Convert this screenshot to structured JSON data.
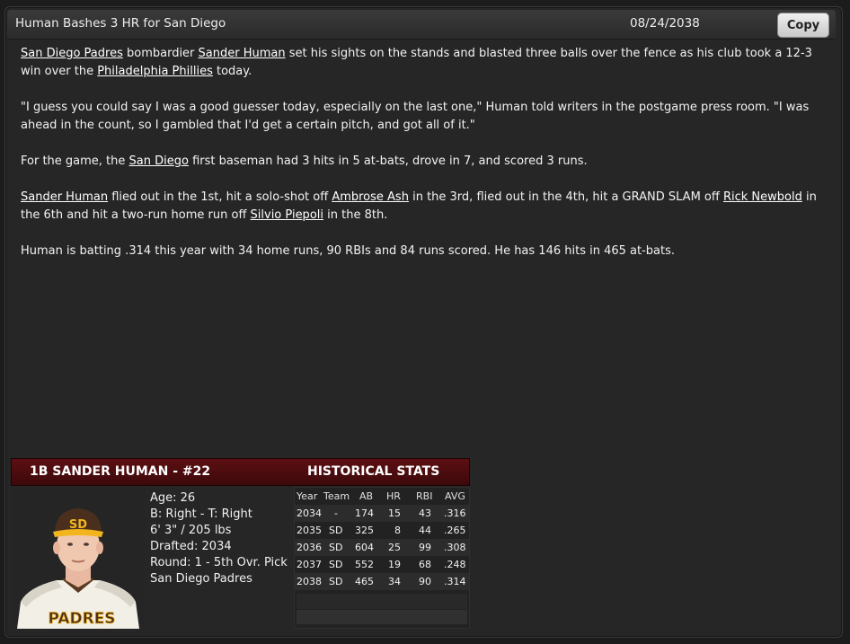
{
  "header": {
    "headline": "Human Bashes 3 HR for San Diego",
    "date": "08/24/2038",
    "copy_label": "Copy"
  },
  "article": {
    "p1": [
      {
        "text": "San Diego Padres",
        "link": true
      },
      {
        "text": " bombardier ",
        "link": false
      },
      {
        "text": "Sander Human",
        "link": true
      },
      {
        "text": " set his sights on the stands and blasted three balls over the fence as his club took a 12-3 win over the ",
        "link": false
      },
      {
        "text": "Philadelphia Phillies",
        "link": true
      },
      {
        "text": " today.",
        "link": false
      }
    ],
    "p2": [
      {
        "text": "\"I guess you could say I was a good guesser today, especially on the last one,\" Human told writers in the postgame press room. \"I was ahead in the count, so I gambled that I'd get a certain pitch, and got all of it.\"",
        "link": false
      }
    ],
    "p3": [
      {
        "text": "For the game, the ",
        "link": false
      },
      {
        "text": "San Diego",
        "link": true
      },
      {
        "text": " first baseman had 3 hits in 5 at-bats, drove in 7, and scored 3 runs.",
        "link": false
      }
    ],
    "p4": [
      {
        "text": "Sander Human",
        "link": true
      },
      {
        "text": " flied out in the 1st, hit a solo-shot off ",
        "link": false
      },
      {
        "text": "Ambrose Ash",
        "link": true
      },
      {
        "text": " in the 3rd, flied out in the 4th, hit a GRAND SLAM off ",
        "link": false
      },
      {
        "text": "Rick Newbold",
        "link": true
      },
      {
        "text": " in the 6th and hit a two-run home run off ",
        "link": false
      },
      {
        "text": "Silvio Piepoli",
        "link": true
      },
      {
        "text": " in the 8th.",
        "link": false
      }
    ],
    "p5": [
      {
        "text": "Human is batting .314 this year with 34 home runs, 90 RBIs and 84 runs scored. He has 146 hits in 465 at-bats.",
        "link": false
      }
    ]
  },
  "player_card": {
    "name": "1B SANDER HUMAN - #22",
    "hist_title": "HISTORICAL STATS",
    "bio": {
      "age": "Age: 26",
      "bats_throws": "B: Right - T: Right",
      "size": "6' 3\" / 205 lbs",
      "drafted": "Drafted: 2034",
      "round": "Round: 1 - 5th Ovr. Pick",
      "team": "San Diego Padres"
    },
    "jersey_text": "PADRES",
    "cap_logo": "SD",
    "stats_headers": [
      "Year",
      "Team",
      "AB",
      "HR",
      "RBI",
      "AVG"
    ],
    "stats_rows": [
      [
        "2034",
        "-",
        "174",
        "15",
        "43",
        ".316"
      ],
      [
        "2035",
        "SD",
        "325",
        "8",
        "44",
        ".265"
      ],
      [
        "2036",
        "SD",
        "604",
        "25",
        "99",
        ".308"
      ],
      [
        "2037",
        "SD",
        "552",
        "19",
        "68",
        ".248"
      ],
      [
        "2038",
        "SD",
        "465",
        "34",
        "90",
        ".314"
      ]
    ]
  },
  "colors": {
    "card_header": "#4f0c0f",
    "background": "#262626",
    "jersey_brown": "#4a2f1d",
    "cap_gold": "#f2b51d"
  }
}
